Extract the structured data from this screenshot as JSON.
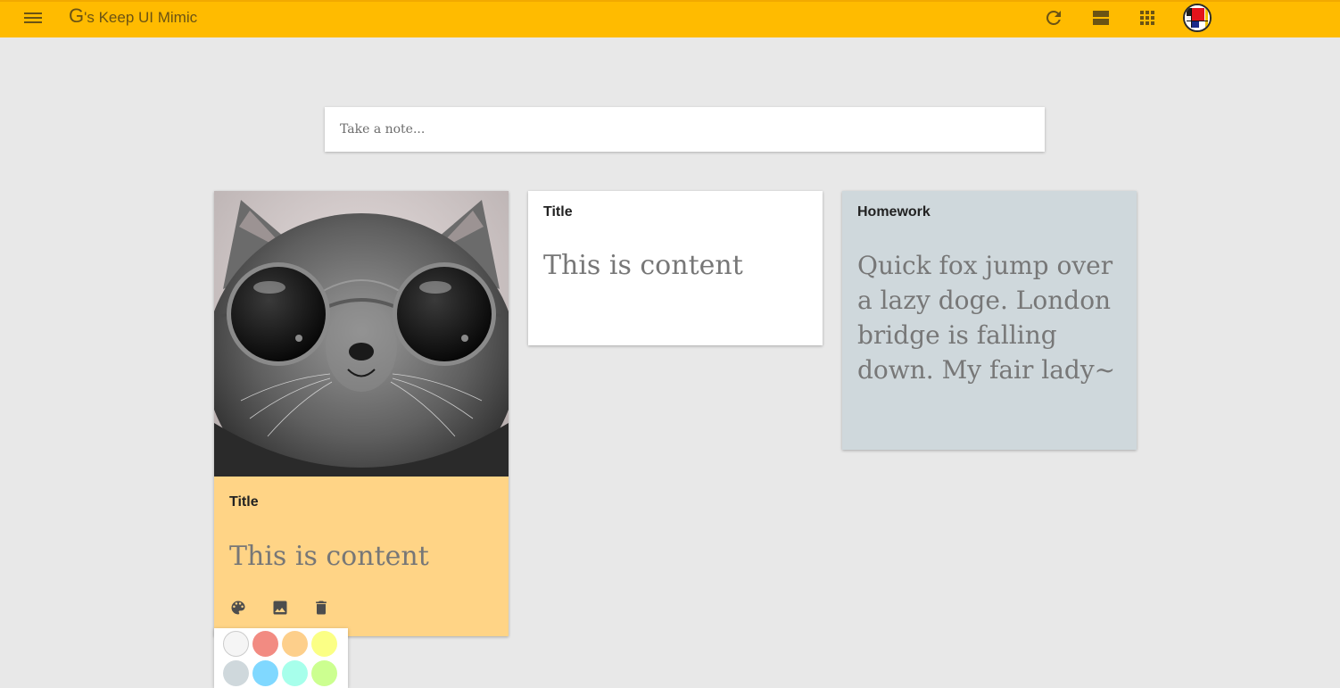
{
  "header": {
    "brand_letter": "G",
    "brand_rest": "'s Keep UI Mimic",
    "background": "#ffbb00",
    "icons": [
      "menu-icon",
      "refresh-icon",
      "list-view-icon",
      "apps-grid-icon",
      "avatar"
    ]
  },
  "composer": {
    "placeholder": "Take a note..."
  },
  "notes": [
    {
      "image": "cat-with-round-sunglasses",
      "title": "Title",
      "content": "This is content",
      "color": "#ffd486",
      "tools": [
        "palette-icon",
        "image-icon",
        "trash-icon"
      ]
    },
    {
      "title": "Title",
      "content": "This is content",
      "color": "#ffffff"
    },
    {
      "title": "Homework",
      "content": "Quick fox jump over a lazy doge. London bridge is falling down. My fair lady~",
      "color": "#cfd8dc"
    }
  ],
  "palette": {
    "colors": [
      "#f5f5f5",
      "#f28b82",
      "#fdcf8b",
      "#fbff85",
      "#cfd8dc",
      "#80d8ff",
      "#a7ffeb",
      "#ccff90"
    ]
  }
}
